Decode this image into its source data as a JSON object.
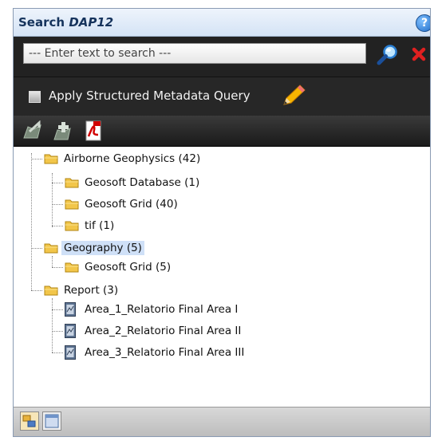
{
  "window": {
    "title_prefix": "Search",
    "title_name": "DAP12"
  },
  "search": {
    "placeholder": "--- Enter text to search ---"
  },
  "query": {
    "label": "Apply Structured Metadata Query"
  },
  "tree": [
    {
      "id": "airborne",
      "label": "Airborne Geophysics (42)",
      "type": "folder",
      "level": 0
    },
    {
      "id": "geosoft-db",
      "label": "Geosoft Database (1)",
      "type": "folder",
      "level": 1
    },
    {
      "id": "geosoft-grid-1",
      "label": "Geosoft Grid (40)",
      "type": "folder",
      "level": 1
    },
    {
      "id": "tif",
      "label": "tif (1)",
      "type": "folder",
      "level": 1
    },
    {
      "id": "geography",
      "label": "Geography (5)",
      "type": "folder",
      "level": 0,
      "selected": true
    },
    {
      "id": "geosoft-grid-2",
      "label": "Geosoft Grid (5)",
      "type": "folder",
      "level": 1
    },
    {
      "id": "report",
      "label": "Report (3)",
      "type": "folder",
      "level": 0
    },
    {
      "id": "area1",
      "label": "Area_1_Relatorio Final Area I",
      "type": "document",
      "level": 1
    },
    {
      "id": "area2",
      "label": "Area_2_Relatorio Final Area II",
      "type": "document",
      "level": 1
    },
    {
      "id": "area3",
      "label": "Area_3_Relatorio Final Area III",
      "type": "document",
      "level": 1
    }
  ]
}
